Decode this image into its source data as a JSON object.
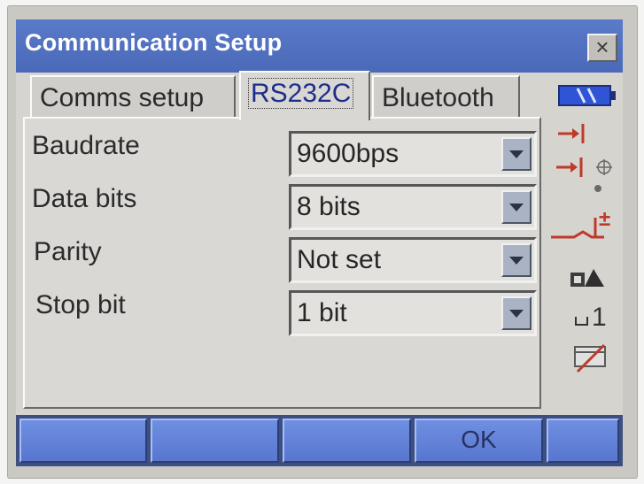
{
  "window": {
    "title": "Communication Setup",
    "close_label": "×"
  },
  "tabs": [
    {
      "label": "Comms setup",
      "active": false
    },
    {
      "label": "RS232C",
      "active": true
    },
    {
      "label": "Bluetooth",
      "active": false
    }
  ],
  "settings": [
    {
      "label": "Baudrate",
      "value": "9600bps"
    },
    {
      "label": "Data bits",
      "value": "8 bits"
    },
    {
      "label": "Parity",
      "value": "Not set"
    },
    {
      "label": "Stop bit",
      "value": "1 bit"
    }
  ],
  "status_icons": [
    "battery-icon",
    "target-arrow-icon",
    "target-arrow-crosshair-icon",
    "dot-icon",
    "tilt-plus-icon",
    "prism-person-icon",
    "constant-icon",
    "no-edit-icon"
  ],
  "status_text": {
    "plus": "±",
    "constant": "1"
  },
  "softkeys": [
    "",
    "",
    "",
    "OK",
    ""
  ],
  "colors": {
    "titlebar": "#4a69b8",
    "softkey": "#5876cf",
    "accent_red": "#c0392b",
    "battery": "#2f54d6"
  }
}
